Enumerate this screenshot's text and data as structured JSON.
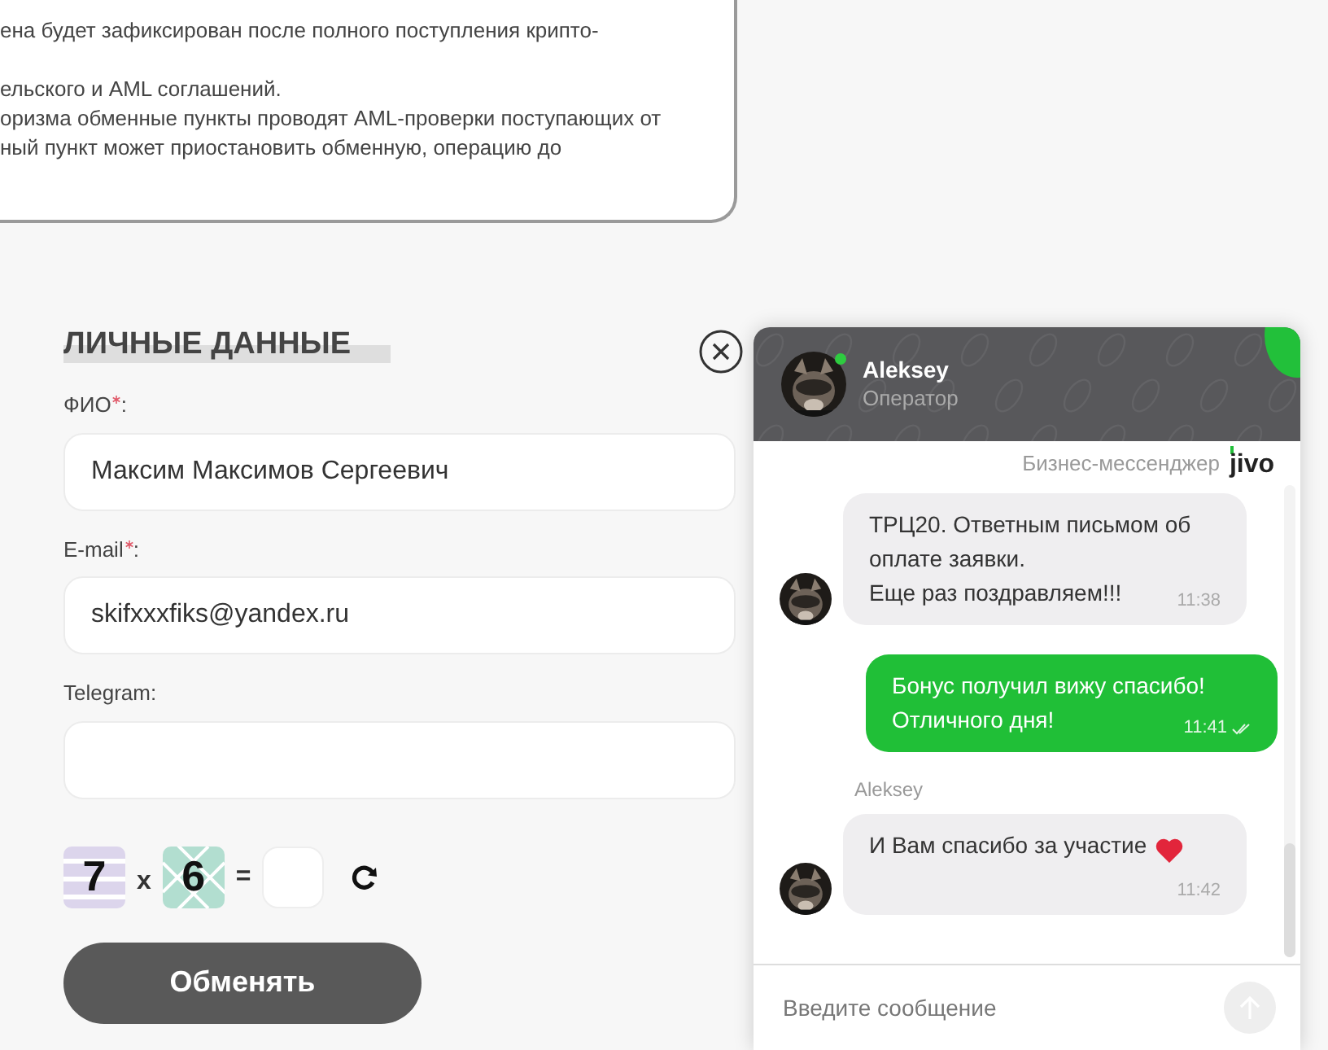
{
  "notice": {
    "paragraphs": [
      [
        "ена будет зафиксирован после полного поступления крипто-"
      ],
      [
        "ельского и AML соглашений.",
        "оризма обменные пункты проводят AML-проверки поступающих от",
        "ный пункт может приостановить обменную, операцию до"
      ]
    ]
  },
  "form": {
    "title": "ЛИЧНЫЕ ДАННЫЕ",
    "fields": [
      {
        "label": "ФИО",
        "required": true,
        "suffix": ":",
        "value": "Максим Максимов Сергеевич"
      },
      {
        "label": "E-mail",
        "required": true,
        "suffix": ":",
        "value": "skifxxxfiks@yandex.ru"
      },
      {
        "label": "Telegram",
        "required": false,
        "suffix": ":"
      }
    ],
    "captcha": {
      "a": "7",
      "op": "x",
      "b": "6",
      "eq": "="
    },
    "submit": "Обменять"
  },
  "chat": {
    "operator": {
      "name": "Aleksey",
      "role": "Оператор",
      "online": true
    },
    "branding": {
      "text": "Бизнес-мессенджер",
      "logo": "jivo"
    },
    "messages": [
      {
        "kind": "in",
        "text": "ТРЦ20. Ответным письмом об\nоплате заявки.\nЕще раз поздравляем!!!",
        "time": "11:38",
        "heart": false
      },
      {
        "kind": "out",
        "text": "Бонус получил вижу спасибо!\nОтличного дня!",
        "time": "11:41",
        "read": true
      },
      {
        "kind": "in",
        "author": "Aleksey",
        "text": "И Вам спасибо за участие",
        "time": "11:42",
        "heart": true
      }
    ],
    "placeholder": "Введите сообщение"
  }
}
